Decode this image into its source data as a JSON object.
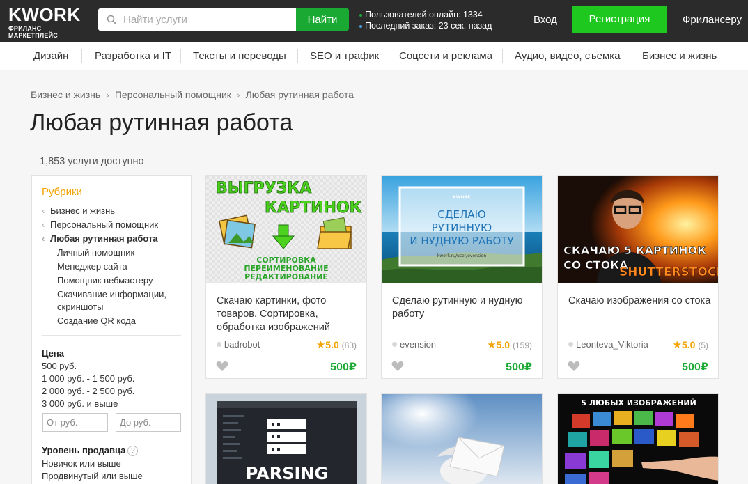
{
  "header": {
    "logo_main": "KWORK",
    "logo_sub": "ФРИЛАНС МАРКЕТПЛЕЙС",
    "search_placeholder": "Найти услуги",
    "search_button": "Найти",
    "stat_online": "Пользователей онлайн: 1334",
    "stat_last_order": "Последний заказ: 23 сек. назад",
    "login": "Вход",
    "register": "Регистрация",
    "freelancer": "Фрилансеру",
    "colors": {
      "accent_green": "#1aaa33",
      "register_green": "#1ec81e",
      "dot_green": "#1aaa33",
      "dot_blue": "#4aa3df"
    }
  },
  "categories": [
    "Дизайн",
    "Разработка и IT",
    "Тексты и переводы",
    "SEO и трафик",
    "Соцсети и реклама",
    "Аудио, видео, съемка",
    "Бизнес и жизнь"
  ],
  "breadcrumb": [
    "Бизнес и жизнь",
    "Персональный помощник",
    "Любая рутинная работа"
  ],
  "page_title": "Любая рутинная работа",
  "count": "1,853 услуги доступно",
  "sidebar": {
    "heading": "Рубрики",
    "parents": [
      "Бизнес и жизнь",
      "Персональный помощник",
      "Любая рутинная работа"
    ],
    "children": [
      "Личный помощник",
      "Менеджер сайта",
      "Помощник вебмастеру",
      "Скачивание информации,",
      "скриншоты",
      "Создание QR кода"
    ],
    "price_heading": "Цена",
    "prices": [
      "500 руб.",
      "1 000 руб. - 1 500 руб.",
      "2 000 руб. - 2 500 руб.",
      "3 000 руб. и выше"
    ],
    "from_placeholder": "От руб.",
    "to_placeholder": "До руб.",
    "level_heading": "Уровень продавца",
    "levels": [
      "Новичок или выше",
      "Продвинутый или выше"
    ]
  },
  "cards": [
    {
      "title": "Скачаю картинки, фото товаров. Сортировка, обработка изображений",
      "seller": "badrobot",
      "rating": "5.0",
      "reviews": "(83)",
      "price": "500₽",
      "img_lines": [
        "ВЫГРУЗКА",
        "КАРТИНОК",
        "СОРТИРОВКА",
        "ПЕРЕИМЕНОВАНИЕ",
        "РЕДАКТИРОВАНИЕ"
      ]
    },
    {
      "title": "Сделаю рутинную и нудную работу",
      "seller": "evension",
      "rating": "5.0",
      "reviews": "(159)",
      "price": "500₽",
      "img_lines": [
        "KWORK",
        "СДЕЛАЮ",
        "РУТИННУЮ",
        "И НУДНУЮ РАБОТУ",
        "kwork.ru/user/evension"
      ]
    },
    {
      "title": "Скачаю изображения со стока",
      "seller": "Leonteva_Viktoria",
      "rating": "5.0",
      "reviews": "(5)",
      "price": "500₽",
      "img_lines": [
        "СКАЧАЮ 5 КАРТИНОК",
        "СО СТОКА",
        "SHUTTERSTOCK"
      ]
    }
  ],
  "row2": {
    "card1_text": "PARSING",
    "card3_text": "5 ЛЮБЫХ ИЗОБРАЖЕНИЙ"
  }
}
